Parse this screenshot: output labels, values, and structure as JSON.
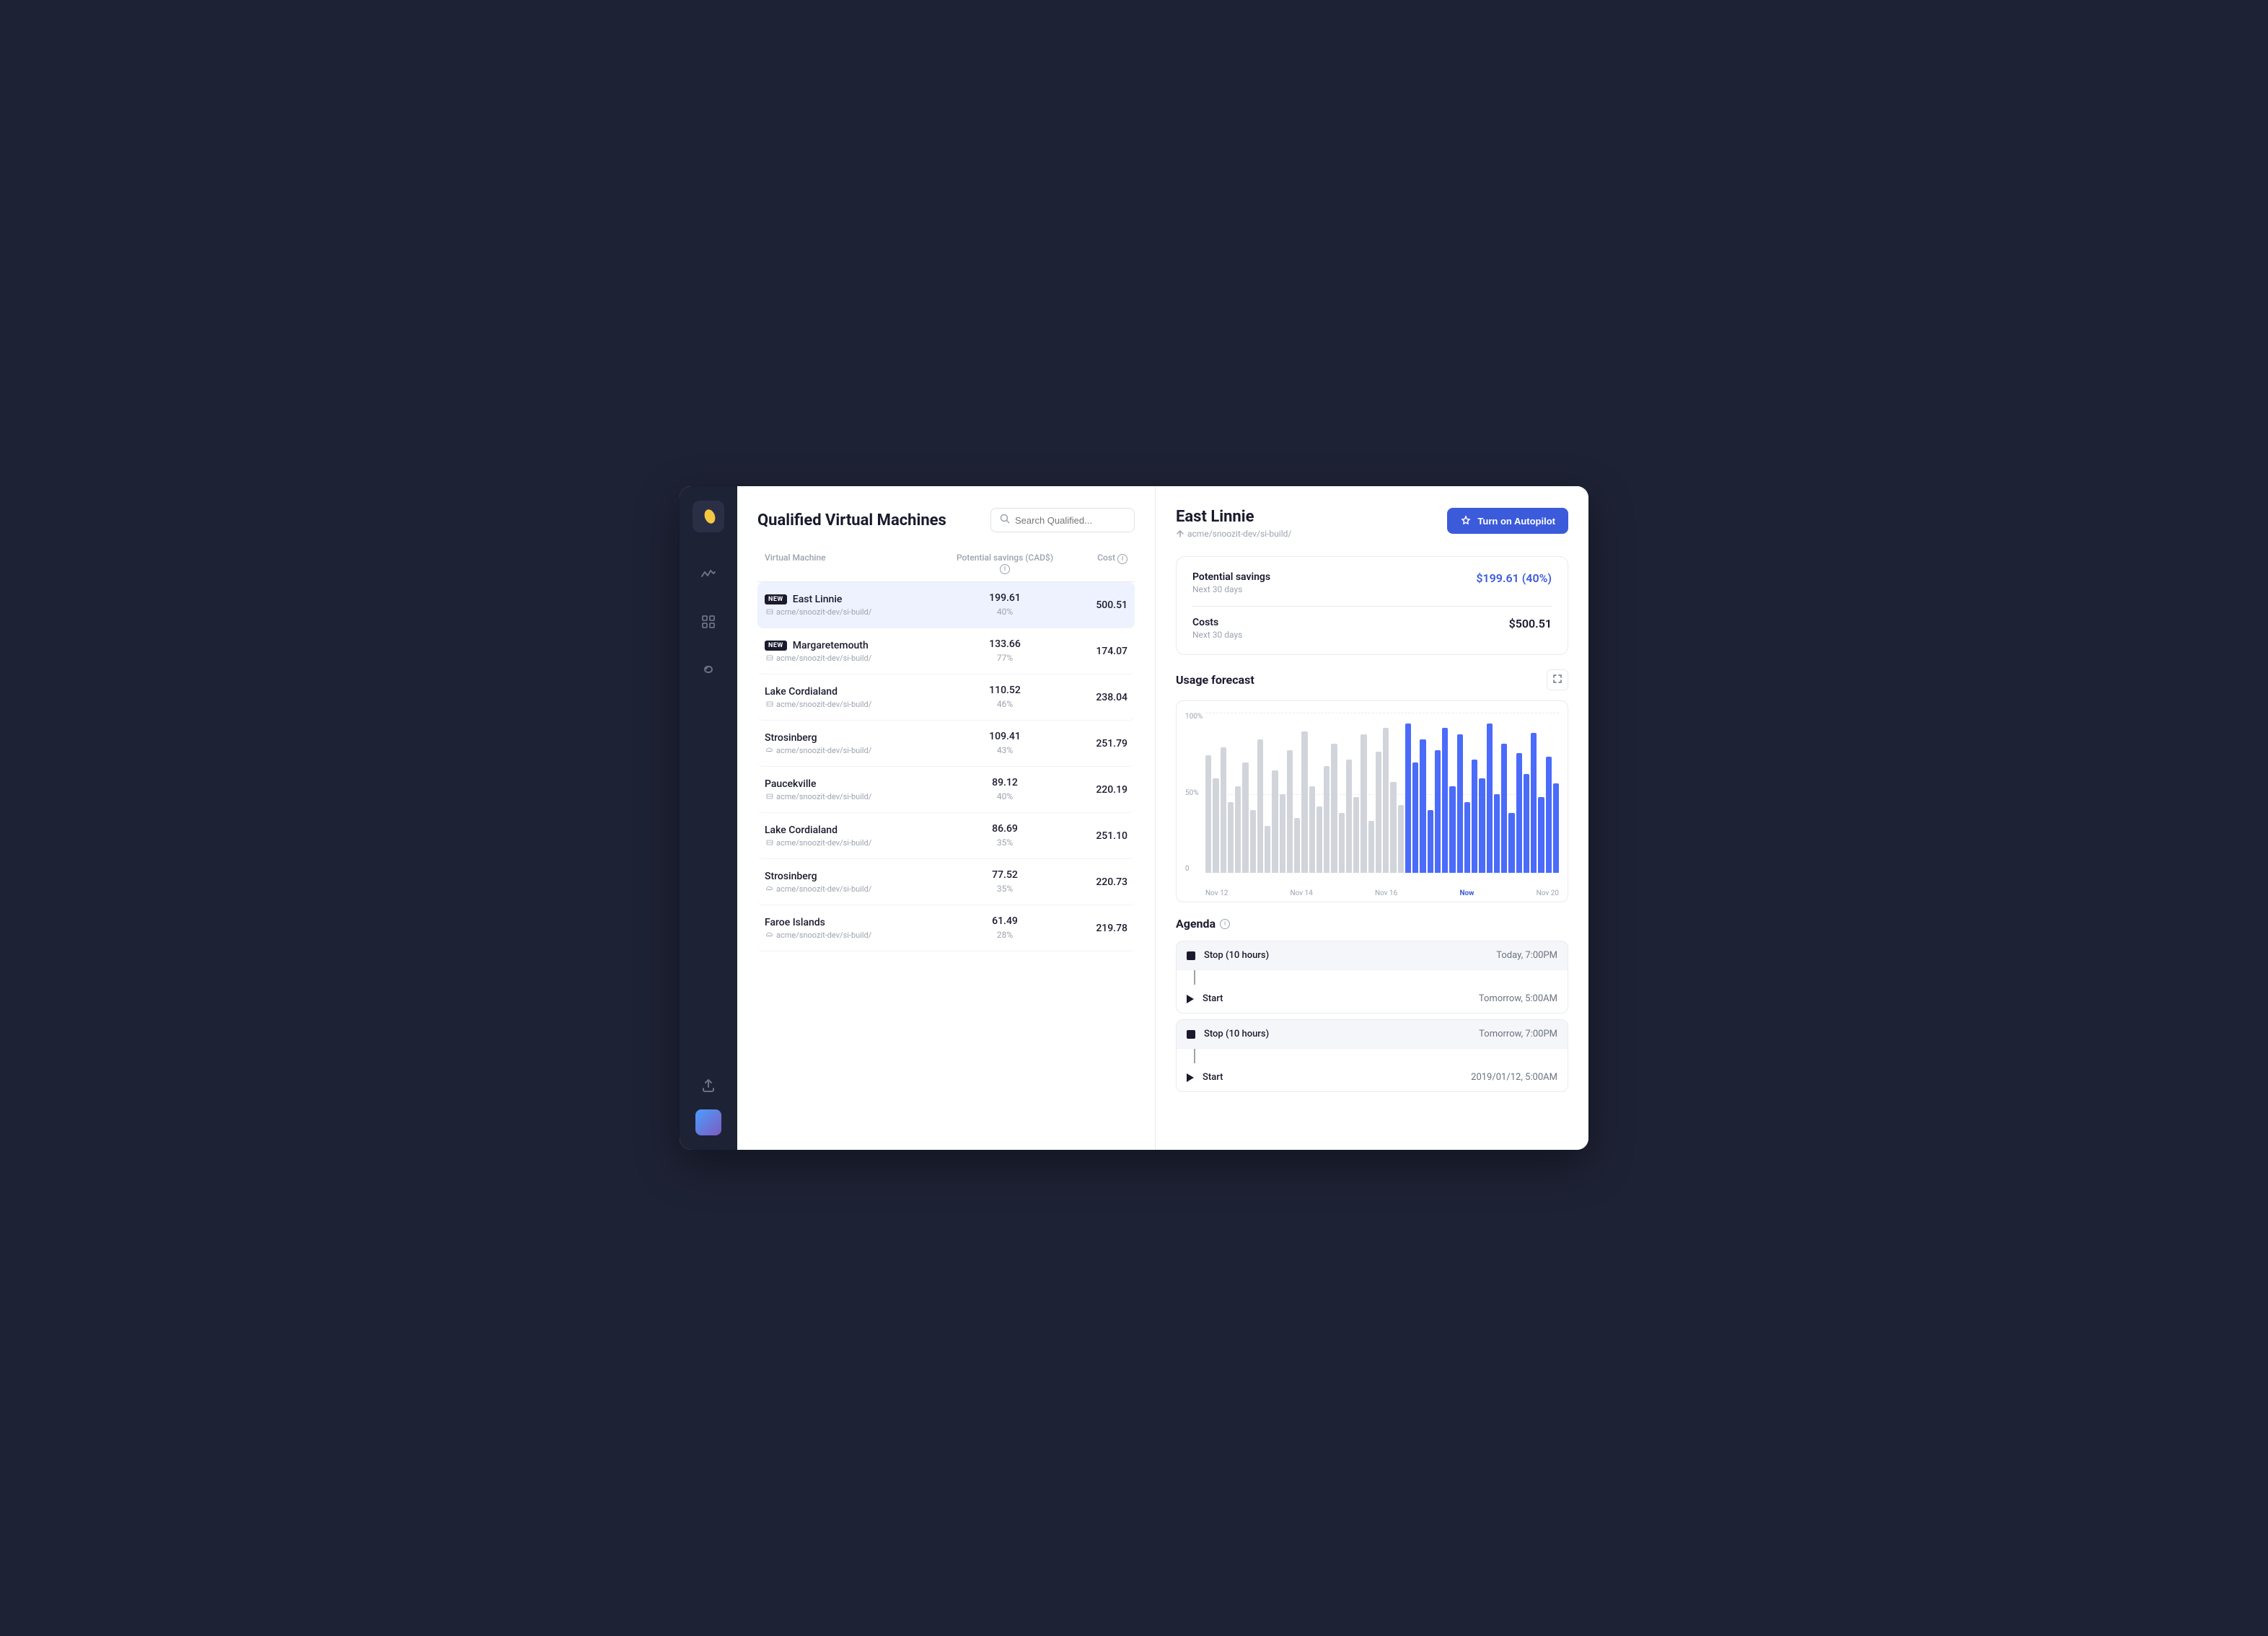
{
  "app": {
    "title": "Qualified Virtual Machines"
  },
  "sidebar": {
    "logo": "🔥",
    "icons": [
      {
        "name": "activity-icon",
        "symbol": "≋"
      },
      {
        "name": "filter-icon",
        "symbol": "⊞"
      },
      {
        "name": "infinity-icon",
        "symbol": "∞"
      },
      {
        "name": "upload-icon",
        "symbol": "⬆"
      },
      {
        "name": "avatar-icon",
        "symbol": "👤"
      }
    ]
  },
  "search": {
    "placeholder": "Search Qualified..."
  },
  "table": {
    "headers": [
      "Virtual Machine",
      "Potential savings (CAD$)",
      "Cost"
    ],
    "rows": [
      {
        "name": "East Linnie",
        "badge": "NEW",
        "path": "acme/snoozit-dev/si-build/",
        "savings": "199.61",
        "savings_pct": "40%",
        "cost": "500.51",
        "selected": true,
        "icon": "vm-icon"
      },
      {
        "name": "Margaretemouth",
        "badge": "NEW",
        "path": "acme/snoozit-dev/si-build/",
        "savings": "133.66",
        "savings_pct": "77%",
        "cost": "174.07",
        "selected": false,
        "icon": "vm-icon"
      },
      {
        "name": "Lake Cordialand",
        "badge": null,
        "path": "acme/snoozit-dev/si-build/",
        "savings": "110.52",
        "savings_pct": "46%",
        "cost": "238.04",
        "selected": false,
        "icon": "server-icon"
      },
      {
        "name": "Strosinberg",
        "badge": null,
        "path": "acme/snoozit-dev/si-build/",
        "savings": "109.41",
        "savings_pct": "43%",
        "cost": "251.79",
        "selected": false,
        "icon": "cloud-icon"
      },
      {
        "name": "Paucekville",
        "badge": null,
        "path": "acme/snoozit-dev/si-build/",
        "savings": "89.12",
        "savings_pct": "40%",
        "cost": "220.19",
        "selected": false,
        "icon": "server-icon"
      },
      {
        "name": "Lake Cordialand",
        "badge": null,
        "path": "acme/snoozit-dev/si-build/",
        "savings": "86.69",
        "savings_pct": "35%",
        "cost": "251.10",
        "selected": false,
        "icon": "server-icon"
      },
      {
        "name": "Strosinberg",
        "badge": null,
        "path": "acme/snoozit-dev/si-build/",
        "savings": "77.52",
        "savings_pct": "35%",
        "cost": "220.73",
        "selected": false,
        "icon": "cloud-icon"
      },
      {
        "name": "Faroe Islands",
        "badge": null,
        "path": "acme/snoozit-dev/si-build/",
        "savings": "61.49",
        "savings_pct": "28%",
        "cost": "219.78",
        "selected": false,
        "icon": "cloud-icon"
      }
    ]
  },
  "detail": {
    "title": "East Linnie",
    "path": "acme/snoozit-dev/si-build/",
    "autopilot_label": "Turn on Autopilot",
    "potential_savings_label": "Potential savings",
    "potential_savings_period": "Next 30 days",
    "potential_savings_value": "$199.61 (40%)",
    "costs_label": "Costs",
    "costs_period": "Next 30 days",
    "costs_value": "$500.51",
    "forecast_title": "Usage forecast",
    "agenda_title": "Agenda",
    "bars": [
      {
        "height": 75,
        "future": false
      },
      {
        "height": 60,
        "future": false
      },
      {
        "height": 80,
        "future": false
      },
      {
        "height": 45,
        "future": false
      },
      {
        "height": 55,
        "future": false
      },
      {
        "height": 70,
        "future": false
      },
      {
        "height": 40,
        "future": false
      },
      {
        "height": 85,
        "future": false
      },
      {
        "height": 30,
        "future": false
      },
      {
        "height": 65,
        "future": false
      },
      {
        "height": 50,
        "future": false
      },
      {
        "height": 78,
        "future": false
      },
      {
        "height": 35,
        "future": false
      },
      {
        "height": 90,
        "future": false
      },
      {
        "height": 55,
        "future": false
      },
      {
        "height": 42,
        "future": false
      },
      {
        "height": 68,
        "future": false
      },
      {
        "height": 82,
        "future": false
      },
      {
        "height": 38,
        "future": false
      },
      {
        "height": 72,
        "future": false
      },
      {
        "height": 48,
        "future": false
      },
      {
        "height": 88,
        "future": false
      },
      {
        "height": 33,
        "future": false
      },
      {
        "height": 77,
        "future": false
      },
      {
        "height": 92,
        "future": false
      },
      {
        "height": 58,
        "future": false
      },
      {
        "height": 43,
        "future": false
      },
      {
        "height": 95,
        "future": true
      },
      {
        "height": 70,
        "future": true
      },
      {
        "height": 85,
        "future": true
      },
      {
        "height": 40,
        "future": true
      },
      {
        "height": 78,
        "future": true
      },
      {
        "height": 92,
        "future": true
      },
      {
        "height": 55,
        "future": true
      },
      {
        "height": 88,
        "future": true
      },
      {
        "height": 45,
        "future": true
      },
      {
        "height": 72,
        "future": true
      },
      {
        "height": 60,
        "future": true
      },
      {
        "height": 95,
        "future": true
      },
      {
        "height": 50,
        "future": true
      },
      {
        "height": 82,
        "future": true
      },
      {
        "height": 38,
        "future": true
      },
      {
        "height": 76,
        "future": true
      },
      {
        "height": 63,
        "future": true
      },
      {
        "height": 89,
        "future": true
      },
      {
        "height": 48,
        "future": true
      },
      {
        "height": 74,
        "future": true
      },
      {
        "height": 57,
        "future": true
      }
    ],
    "x_labels": [
      "Nov 12",
      "Nov 14",
      "Nov 16",
      "Now",
      "Nov 20"
    ],
    "y_labels": [
      "100%",
      "50%",
      "0"
    ],
    "agenda_groups": [
      {
        "items": [
          {
            "type": "stop",
            "action": "Stop (10 hours)",
            "time": "Today, 7:00PM"
          },
          {
            "type": "start",
            "action": "Start",
            "time": "Tomorrow, 5:00AM"
          }
        ]
      },
      {
        "items": [
          {
            "type": "stop",
            "action": "Stop (10 hours)",
            "time": "Tomorrow, 7:00PM"
          },
          {
            "type": "start",
            "action": "Start",
            "time": "2019/01/12, 5:00AM"
          }
        ]
      }
    ]
  }
}
